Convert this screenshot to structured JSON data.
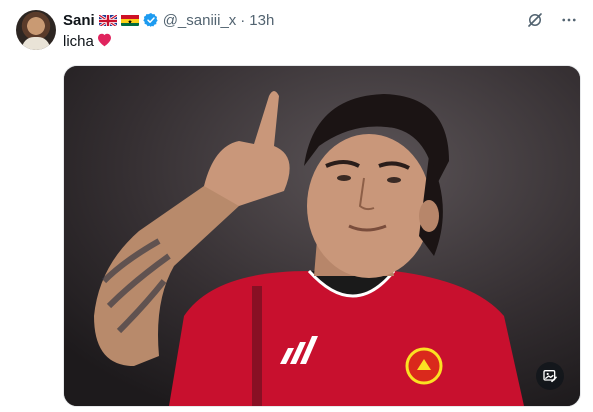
{
  "tweet": {
    "author": {
      "name": "Sani",
      "handle": "@_saniii_x",
      "time": "13h",
      "separator": "·"
    },
    "text": "licha",
    "text_emoji": "heart-icon"
  },
  "colors": {
    "accent": "#1d9bf0",
    "muted": "#536471",
    "heart": "#e0245e",
    "shirt_red": "#c8102e"
  },
  "icons": {
    "grok": "grok-icon",
    "more": "more-icon",
    "alt": "image-edit-icon"
  }
}
